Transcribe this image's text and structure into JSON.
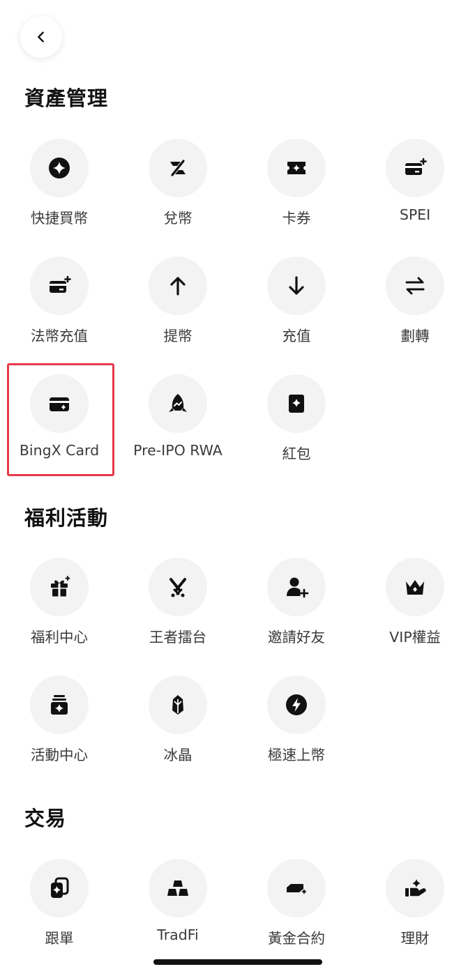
{
  "sections": [
    {
      "title": "資產管理",
      "items": [
        {
          "label": "快捷買幣",
          "icon": "sparkle-coin-icon"
        },
        {
          "label": "兌幣",
          "icon": "convert-icon"
        },
        {
          "label": "卡券",
          "icon": "ticket-icon"
        },
        {
          "label": "SPEI",
          "icon": "card-add-icon"
        },
        {
          "label": "法幣充值",
          "icon": "card-add-icon"
        },
        {
          "label": "提幣",
          "icon": "arrow-up-icon"
        },
        {
          "label": "充值",
          "icon": "arrow-down-icon"
        },
        {
          "label": "劃轉",
          "icon": "transfer-icon"
        },
        {
          "label": "BingX Card",
          "icon": "wallet-card-icon"
        },
        {
          "label": "Pre-IPO RWA",
          "icon": "rocket-icon"
        },
        {
          "label": "紅包",
          "icon": "red-packet-icon"
        }
      ]
    },
    {
      "title": "福利活動",
      "items": [
        {
          "label": "福利中心",
          "icon": "gift-icon"
        },
        {
          "label": "王者擂台",
          "icon": "crossed-swords-icon"
        },
        {
          "label": "邀請好友",
          "icon": "add-user-icon"
        },
        {
          "label": "VIP權益",
          "icon": "crown-icon"
        },
        {
          "label": "活動中心",
          "icon": "event-box-icon"
        },
        {
          "label": "冰晶",
          "icon": "crystal-icon"
        },
        {
          "label": "極速上幣",
          "icon": "lightning-icon"
        }
      ]
    },
    {
      "title": "交易",
      "items": [
        {
          "label": "跟單",
          "icon": "copy-trade-icon"
        },
        {
          "label": "TradFi",
          "icon": "gold-bars-icon"
        },
        {
          "label": "黃金合約",
          "icon": "gold-bar-sparkle-icon"
        },
        {
          "label": "理財",
          "icon": "hand-money-icon"
        }
      ]
    }
  ],
  "highlighted_item": "BingX Card",
  "colors": {
    "icon": "#111111",
    "icon_bg": "#f3f3f3",
    "highlight_border": "#e8394a",
    "label": "#3a3a3a"
  }
}
